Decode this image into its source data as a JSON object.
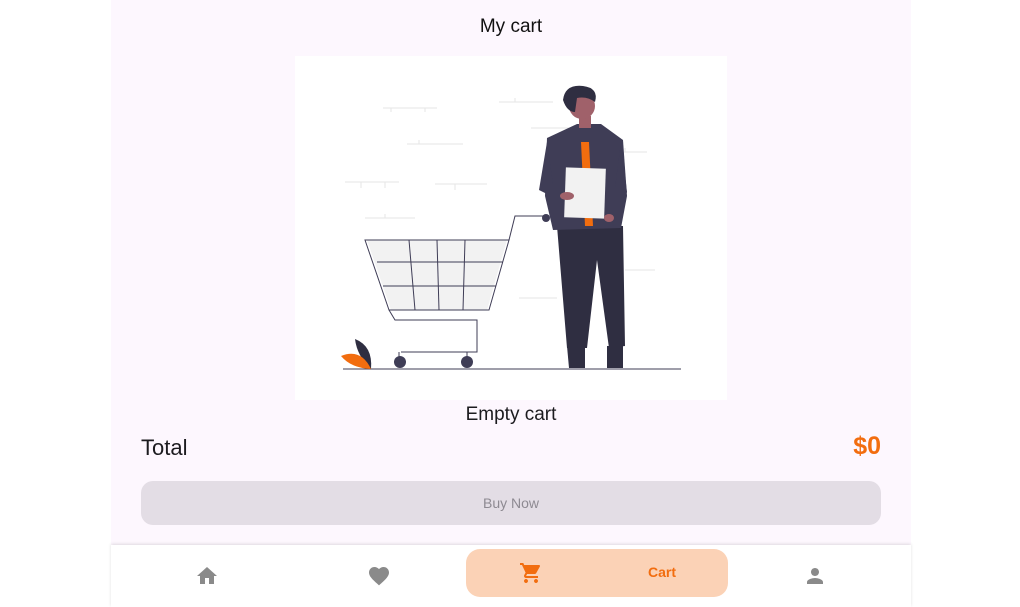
{
  "header": {
    "title": "My cart"
  },
  "empty_state": {
    "label": "Empty cart",
    "illustration": "person-with-shopping-cart-illustration"
  },
  "summary": {
    "total_label": "Total",
    "total_value": "$0"
  },
  "actions": {
    "buy_label": "Buy Now"
  },
  "bottom_nav": {
    "items": [
      {
        "icon": "home-icon"
      },
      {
        "icon": "heart-icon"
      },
      {
        "icon": "cart-icon",
        "label": "Cart",
        "active": true
      },
      {
        "icon": "person-icon"
      }
    ]
  },
  "colors": {
    "accent": "#f26d0f",
    "accent_soft": "#fbd2b6",
    "background": "#fdf7fe",
    "disabled_button": "#e3dde5",
    "icon_inactive": "#8a8a8a"
  }
}
